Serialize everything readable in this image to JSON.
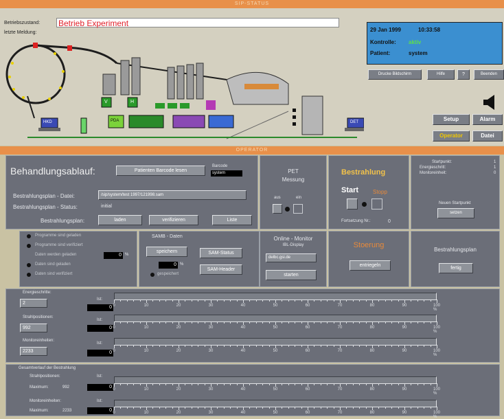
{
  "titles": {
    "top": "SIP-STATUS",
    "mid": "OPERATOR"
  },
  "top": {
    "betriebszustand_label": "Betriebszustand:",
    "betriebszustand_value": "Betrieb  Experiment",
    "meldung_label": "letzte Meldung:"
  },
  "info": {
    "date": "29 Jan 1999",
    "time": "10:33:58",
    "kontrolle_label": "Kontrolle:",
    "kontrolle_value": "aktiv",
    "patient_label": "Patient:",
    "patient_value": "system"
  },
  "buttons_top": {
    "drucke": "Drucke Bildschirm",
    "hilfe": "Hilfe",
    "hilfe_q": "?",
    "beenden": "Beenden",
    "setup": "Setup",
    "alarm": "Alarm",
    "operator": "Operator",
    "datei": "Datei"
  },
  "schematic": {
    "boxes": [
      "V",
      "H",
      "PDA",
      "HKD",
      "DET"
    ]
  },
  "ablauf": {
    "title": "Behandlungsablauf:",
    "barcode_button": "Patienten Barcode lesen",
    "barcode_label": "Barcode",
    "barcode_value": "system",
    "plan_datei_label": "Bestrahlungsplan - Datei:",
    "plan_datei_value": "/sip/system/test 1997/121998.sam",
    "plan_status_label": "Bestrahlungsplan - Status:",
    "plan_status_value": "initial",
    "plan_label": "Bestrahlungsplan:",
    "laden": "laden",
    "verifizieren": "verifizieren",
    "liste": "Liste"
  },
  "pet": {
    "title": "PET",
    "title2": "Messung",
    "aus": "aus",
    "ein": "ein"
  },
  "bestrahlung": {
    "title": "Bestrahlung",
    "start": "Start",
    "stopp": "Stopp",
    "fortsetzung": "Fortsetzung Nr.:",
    "fortsetzung_value": "0"
  },
  "startpunkt": {
    "l1": "Startpunkt:",
    "v1": "1",
    "l2": "Energieschritt:",
    "v2": "1",
    "l3": "Monitoreinheit:",
    "v3": "0",
    "neuer_label": "Neuen Startpunkt",
    "setzen": "setzen"
  },
  "status_list": [
    "Programme sind geladen",
    "Programme sind verifiziert",
    "Daten werden geladen",
    "Daten sind geladen",
    "Daten sind verifiziert"
  ],
  "status_percent": "0",
  "samb": {
    "title": "SAMB - Daten",
    "speichern": "speichern",
    "gespeichert": "gespeichert",
    "percent": "0",
    "status": "SAM-Status",
    "header": "SAM-Header"
  },
  "online": {
    "title": "Online - Monitor",
    "sub": "IBL-Display",
    "host": "delbc.gsi.de",
    "starten": "starten"
  },
  "stoerung": {
    "title": "Stoerung",
    "entriegeln": "entriegeln"
  },
  "bplan2": {
    "title": "Bestrahlungsplan",
    "fertig": "fertig"
  },
  "progress": {
    "energie_label": "Energieschritte:",
    "energie_value": "2",
    "strahl_label": "Strahlpositionen:",
    "strahl_value": "992",
    "monitor_label": "Monitoreinheiten:",
    "monitor_value": "2233",
    "ist": "Ist:",
    "ist_value": "0",
    "gesamt_title": "Gesamtverlauf der Bestrahlung",
    "g_strahl_label": "Strahlpositionen:",
    "g_monitor_label": "Monitoreinheiten:",
    "maximum": "Maximum:",
    "g_strahl_max": "992",
    "g_monitor_max": "2233",
    "percent_unit": "%",
    "scale": [
      "0",
      "10",
      "20",
      "30",
      "40",
      "50",
      "60",
      "70",
      "80",
      "90",
      "100"
    ]
  }
}
